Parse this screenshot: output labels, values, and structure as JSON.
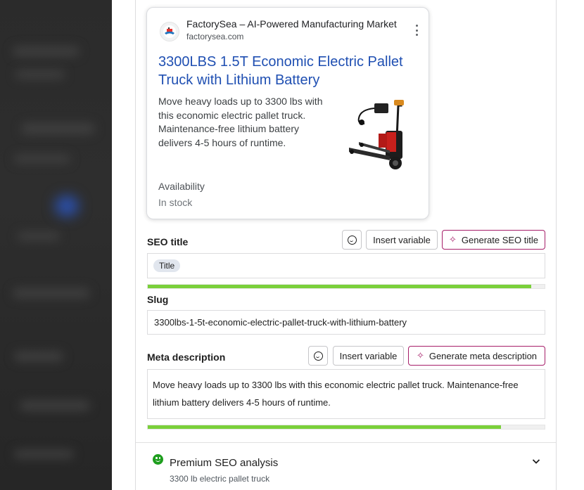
{
  "preview": {
    "site_name": "FactorySea – AI-Powered Manufacturing Market",
    "site_url": "factorysea.com",
    "title": "3300LBS 1.5T Economic Electric Pallet Truck with Lithium Battery",
    "snippet": "Move heavy loads up to 3300 lbs with this economic electric pallet truck. Maintenance-free lithium battery delivers 4-5 hours of runtime.",
    "availability_label": "Availability",
    "availability_value": "In stock",
    "site_icon": "factorysea-logo-icon",
    "thumbnail": "electric-pallet-truck-image"
  },
  "seo_title": {
    "label": "SEO title",
    "insert_variable": "Insert variable",
    "generate": "Generate SEO title",
    "chip": "Title",
    "progress": 0.966
  },
  "slug": {
    "label": "Slug",
    "value": "3300lbs-1-5t-economic-electric-pallet-truck-with-lithium-battery"
  },
  "meta_description": {
    "label": "Meta description",
    "insert_variable": "Insert variable",
    "generate": "Generate meta description",
    "value": "Move heavy loads up to 3300 lbs with this economic electric pallet truck. Maintenance-free lithium battery delivers 4-5 hours of runtime.",
    "progress": 0.89
  },
  "premium_seo": {
    "title": "Premium SEO analysis",
    "keyphrase": "3300 lb electric pallet truck"
  },
  "colors": {
    "accent_purple": "#a61e69",
    "progress_green": "#7ad03a",
    "link_blue": "#1f4fb2",
    "status_green": "#1e9e1e"
  }
}
